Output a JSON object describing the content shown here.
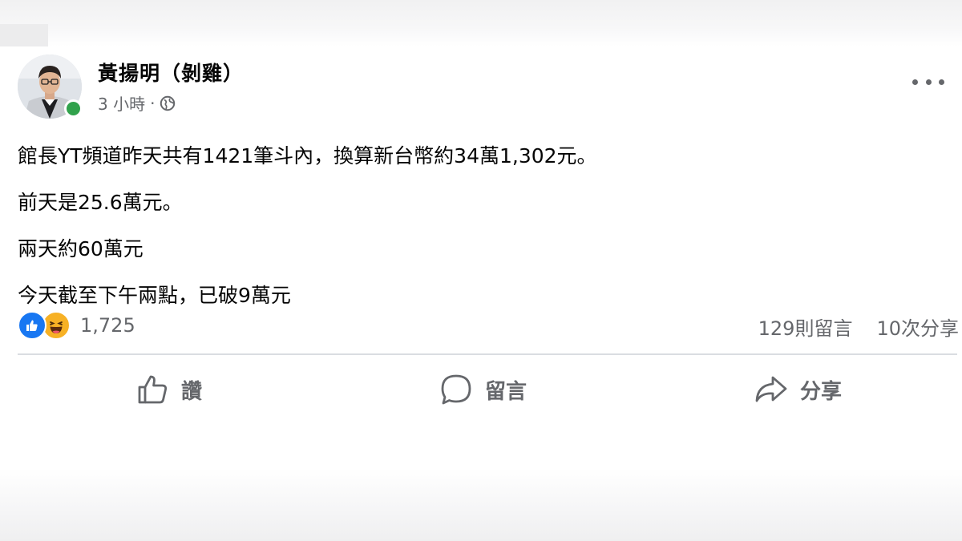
{
  "post": {
    "author_name": "黃揚明（剝雞）",
    "timestamp": "3 小時",
    "separator": "·",
    "privacy_icon": "globe-icon",
    "more_icon": "more-horizontal-icon",
    "body_lines": [
      "館長YT頻道昨天共有1421筆斗內，換算新台幣約34萬1,302元。",
      "前天是25.6萬元。",
      "兩天約60萬元",
      "今天截至下午兩點，已破9萬元"
    ]
  },
  "reactions": {
    "icons": [
      "like-reaction-icon",
      "haha-reaction-icon"
    ],
    "count": "1,725",
    "comments_count": "129則留言",
    "shares_count": "10次分享"
  },
  "actions": {
    "like_label": "讚",
    "comment_label": "留言",
    "share_label": "分享"
  },
  "colors": {
    "facebook_blue": "#1877f2",
    "haha_yellow": "#f7b125",
    "online_green": "#31a24c",
    "secondary_text": "#65676b",
    "divider": "#dadde1"
  }
}
